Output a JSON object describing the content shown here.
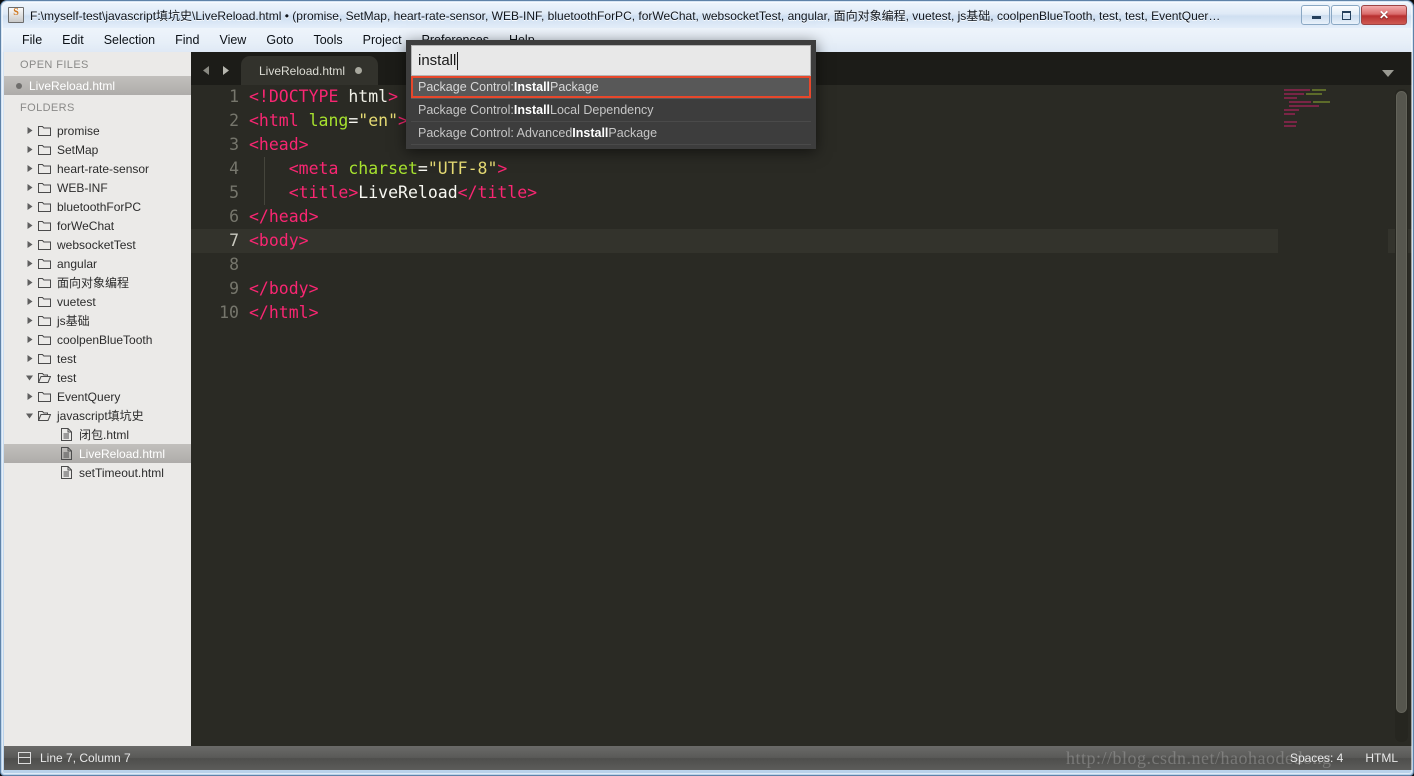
{
  "window": {
    "title": "F:\\myself-test\\javascript填坑史\\LiveReload.html • (promise, SetMap, heart-rate-sensor, WEB-INF, bluetoothForPC, forWeChat, websocketTest, angular, 面向对象编程, vuetest, js基础, coolpenBlueTooth, test, test, EventQuer…",
    "app_icon": "sublime-text-icon",
    "minimize_label": "",
    "maximize_label": "",
    "close_label": "✕"
  },
  "menubar": {
    "items": [
      "File",
      "Edit",
      "Selection",
      "Find",
      "View",
      "Goto",
      "Tools",
      "Project",
      "Preferences",
      "Help"
    ]
  },
  "sidebar": {
    "open_files_header": "OPEN FILES",
    "open_files": [
      {
        "label": "LiveReload.html",
        "selected": true
      }
    ],
    "folders_header": "FOLDERS",
    "tree": [
      {
        "label": "promise",
        "depth": 0,
        "type": "folder",
        "expanded": false,
        "selected": false
      },
      {
        "label": "SetMap",
        "depth": 0,
        "type": "folder",
        "expanded": false,
        "selected": false
      },
      {
        "label": "heart-rate-sensor",
        "depth": 0,
        "type": "folder",
        "expanded": false,
        "selected": false
      },
      {
        "label": "WEB-INF",
        "depth": 0,
        "type": "folder",
        "expanded": false,
        "selected": false
      },
      {
        "label": "bluetoothForPC",
        "depth": 0,
        "type": "folder",
        "expanded": false,
        "selected": false
      },
      {
        "label": "forWeChat",
        "depth": 0,
        "type": "folder",
        "expanded": false,
        "selected": false
      },
      {
        "label": "websocketTest",
        "depth": 0,
        "type": "folder",
        "expanded": false,
        "selected": false
      },
      {
        "label": "angular",
        "depth": 0,
        "type": "folder",
        "expanded": false,
        "selected": false
      },
      {
        "label": "面向对象编程",
        "depth": 0,
        "type": "folder",
        "expanded": false,
        "selected": false
      },
      {
        "label": "vuetest",
        "depth": 0,
        "type": "folder",
        "expanded": false,
        "selected": false
      },
      {
        "label": "js基础",
        "depth": 0,
        "type": "folder",
        "expanded": false,
        "selected": false
      },
      {
        "label": "coolpenBlueTooth",
        "depth": 0,
        "type": "folder",
        "expanded": false,
        "selected": false
      },
      {
        "label": "test",
        "depth": 0,
        "type": "folder",
        "expanded": false,
        "selected": false
      },
      {
        "label": "test",
        "depth": 0,
        "type": "folder",
        "expanded": true,
        "selected": false
      },
      {
        "label": "EventQuery",
        "depth": 0,
        "type": "folder",
        "expanded": false,
        "selected": false
      },
      {
        "label": "javascript填坑史",
        "depth": 0,
        "type": "folder",
        "expanded": true,
        "selected": false
      },
      {
        "label": "闭包.html",
        "depth": 1,
        "type": "file",
        "expanded": false,
        "selected": false
      },
      {
        "label": "LiveReload.html",
        "depth": 1,
        "type": "file",
        "expanded": false,
        "selected": true
      },
      {
        "label": "setTimeout.html",
        "depth": 1,
        "type": "file",
        "expanded": false,
        "selected": false
      }
    ]
  },
  "tabbar": {
    "prev_icon": "arrow-left-icon",
    "next_icon": "arrow-right-icon",
    "tabs": [
      {
        "label": "LiveReload.html",
        "dirty": true,
        "active": true
      }
    ],
    "dropdown_icon": "chevron-down-icon"
  },
  "editor": {
    "lines": [
      {
        "n": "1",
        "active": false,
        "tokens": [
          {
            "t": "tag",
            "v": "<!DOCTYPE"
          },
          {
            "t": "txt",
            "v": " "
          },
          {
            "t": "name",
            "v": "html"
          },
          {
            "t": "tag",
            "v": ">"
          }
        ]
      },
      {
        "n": "2",
        "active": false,
        "tokens": [
          {
            "t": "tag",
            "v": "<html"
          },
          {
            "t": "txt",
            "v": " "
          },
          {
            "t": "attr",
            "v": "lang"
          },
          {
            "t": "txt",
            "v": "="
          },
          {
            "t": "str",
            "v": "\"en\""
          },
          {
            "t": "tag",
            "v": ">"
          }
        ]
      },
      {
        "n": "3",
        "active": false,
        "tokens": [
          {
            "t": "tag",
            "v": "<head>"
          }
        ]
      },
      {
        "n": "4",
        "active": false,
        "tokens": [
          {
            "t": "txt",
            "v": "    "
          },
          {
            "t": "tag",
            "v": "<meta"
          },
          {
            "t": "txt",
            "v": " "
          },
          {
            "t": "attr",
            "v": "charset"
          },
          {
            "t": "txt",
            "v": "="
          },
          {
            "t": "str",
            "v": "\"UTF-8\""
          },
          {
            "t": "tag",
            "v": ">"
          }
        ]
      },
      {
        "n": "5",
        "active": false,
        "tokens": [
          {
            "t": "txt",
            "v": "    "
          },
          {
            "t": "tag",
            "v": "<title>"
          },
          {
            "t": "txt",
            "v": "LiveReload"
          },
          {
            "t": "tag",
            "v": "</title>"
          }
        ]
      },
      {
        "n": "6",
        "active": false,
        "tokens": [
          {
            "t": "tag",
            "v": "</head>"
          }
        ]
      },
      {
        "n": "7",
        "active": true,
        "tokens": [
          {
            "t": "tag",
            "v": "<body>"
          }
        ]
      },
      {
        "n": "8",
        "active": false,
        "tokens": [
          {
            "t": "txt",
            "v": ""
          }
        ]
      },
      {
        "n": "9",
        "active": false,
        "tokens": [
          {
            "t": "tag",
            "v": "</body>"
          }
        ]
      },
      {
        "n": "10",
        "active": false,
        "tokens": [
          {
            "t": "tag",
            "v": "</html>"
          }
        ]
      }
    ]
  },
  "palette": {
    "query": "install",
    "placeholder": "",
    "items": [
      {
        "pre": "Package Control: ",
        "match": "Install",
        "post": " Package",
        "selected": true
      },
      {
        "pre": "Package Control: ",
        "match": "Install",
        "post": " Local Dependency",
        "selected": false
      },
      {
        "pre": "Package Control: Advanced ",
        "match": "Install",
        "post": " Package",
        "selected": false
      }
    ]
  },
  "statusbar": {
    "icon": "panel-toggle-icon",
    "position": "Line 7, Column 7",
    "indent": "Spaces: 4",
    "syntax": "HTML"
  },
  "watermark": "http://blog.csdn.net/haohaodedong",
  "colors": {
    "tag": "#f92672",
    "attribute": "#a6e22e",
    "string": "#e6db74",
    "text": "#f8f8f2",
    "editor_bg": "#2a2a24",
    "sidebar_bg": "#ebeae8",
    "selection_outline": "#e8472b",
    "tab_bar_bg": "#1c1c18"
  }
}
